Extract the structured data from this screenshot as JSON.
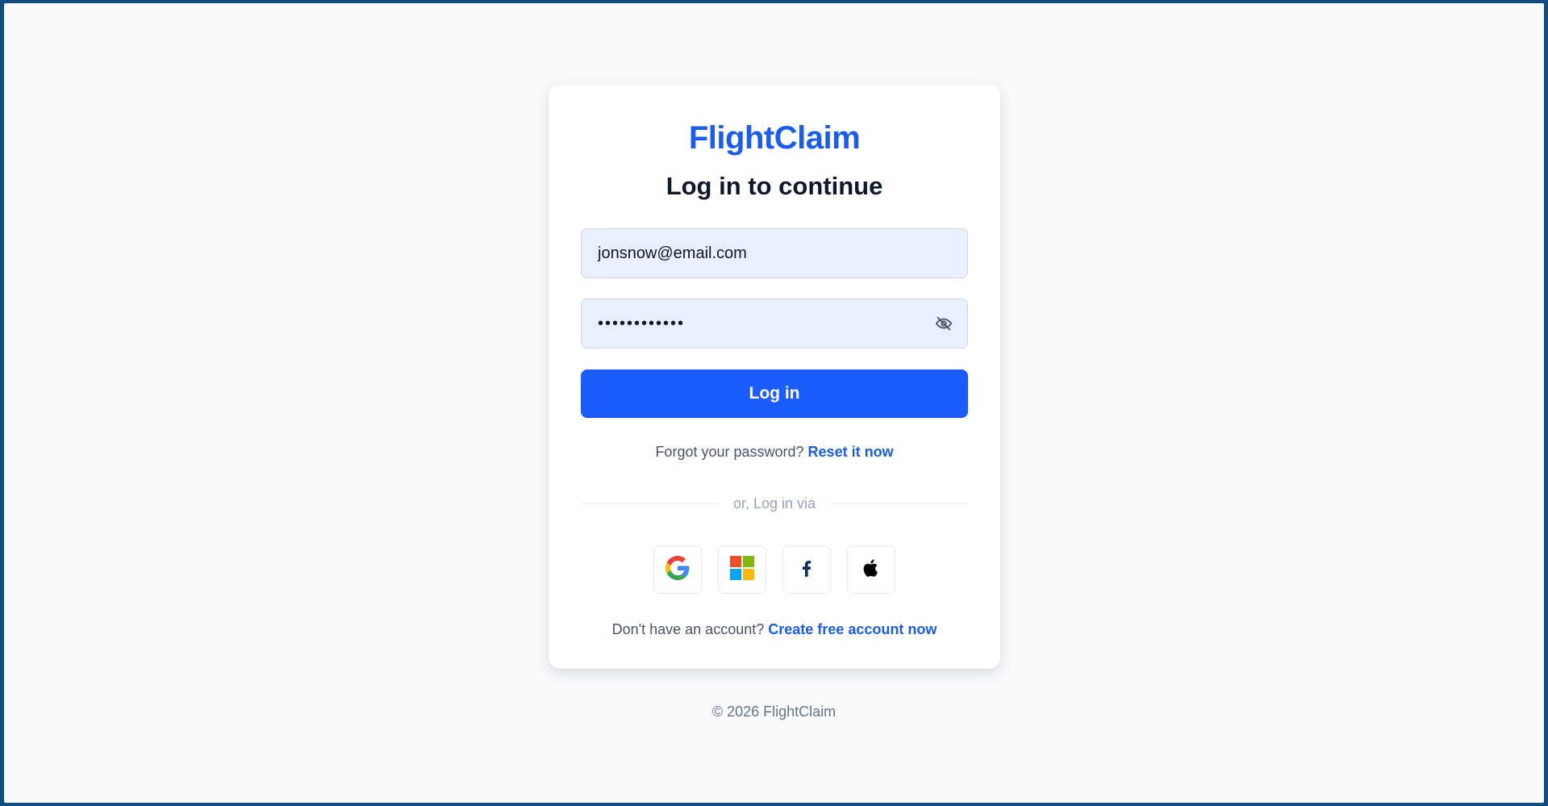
{
  "brand": "FlightClaim",
  "heading": "Log in to continue",
  "form": {
    "email_value": "jonsnow@email.com",
    "password_value": "••••••••••••",
    "login_label": "Log in"
  },
  "forgot": {
    "text": "Forgot your password?",
    "link": "Reset it now"
  },
  "divider_text": "or, Log in via",
  "socials": [
    {
      "name": "google",
      "icon": "google-icon"
    },
    {
      "name": "microsoft",
      "icon": "microsoft-icon"
    },
    {
      "name": "facebook",
      "icon": "facebook-icon"
    },
    {
      "name": "apple",
      "icon": "apple-icon"
    }
  ],
  "signup": {
    "text": "Don't have an account?",
    "link": "Create free account now"
  },
  "footer": "© 2026 FlightClaim",
  "colors": {
    "brand": "#1a5cf0",
    "button": "#1a5cff",
    "field_bg": "#e8f0fe",
    "frame": "#0f4c81"
  }
}
